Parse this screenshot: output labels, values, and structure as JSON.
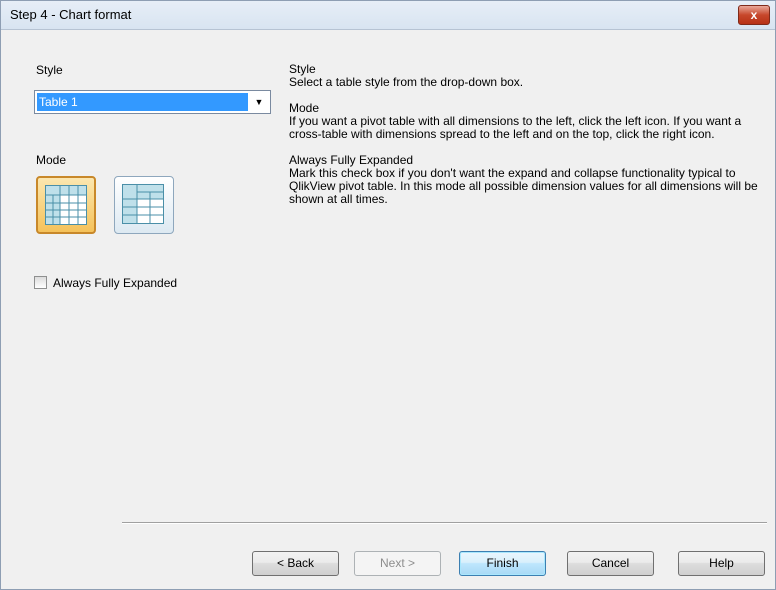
{
  "window": {
    "title": "Step 4 - Chart format",
    "close_label": "x"
  },
  "left_panel": {
    "style_label": "Style",
    "style_selected": "Table 1",
    "mode_label": "Mode",
    "mode_options": [
      "pivot-left-icon",
      "cross-table-icon"
    ],
    "mode_selected": "pivot-left-icon",
    "always_expanded_label": "Always Fully Expanded",
    "always_expanded_checked": false
  },
  "help": {
    "style_heading": "Style",
    "style_text": "Select a table style from the drop-down box.",
    "mode_heading": "Mode",
    "mode_text": "If you want a pivot table with all dimensions to the left, click the left icon. If you want a cross-table with dimensions spread to the left and on the top, click the right icon.",
    "expanded_heading": "Always Fully Expanded",
    "expanded_text": "Mark this check box if you don't want the expand and collapse functionality typical to QlikView pivot table. In this mode all possible dimension values for all dimensions will be shown at all times."
  },
  "buttons": {
    "back": "< Back",
    "next": "Next >",
    "finish": "Finish",
    "cancel": "Cancel",
    "help": "Help"
  },
  "colors": {
    "selection": "#3399ff",
    "mode_selected_fill": "#f5c25a",
    "close_button": "#c7472b"
  }
}
